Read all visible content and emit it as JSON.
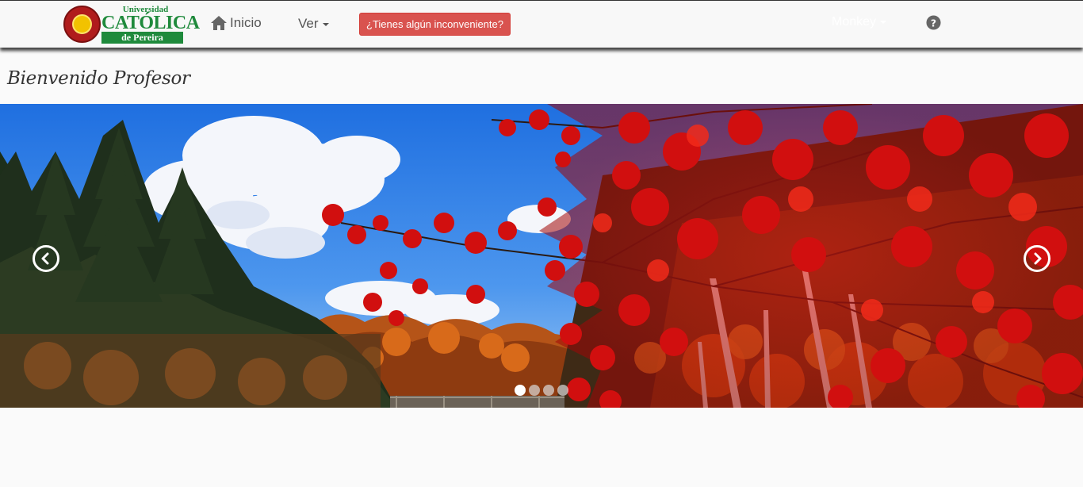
{
  "navbar": {
    "logo": {
      "line1": "Universidad",
      "line2": "CATÓLICA",
      "line3": "de Pereira"
    },
    "home": {
      "label": "Inicio",
      "icon": "home-icon"
    },
    "ver": {
      "label": "Ver"
    },
    "help_button": {
      "label": "¿Tienes algún inconveniente?",
      "color": "#d9534f"
    },
    "user_menu": {
      "label": "Monkey"
    },
    "question_icon": "question-circle-icon"
  },
  "page": {
    "title": "Bienvenido Profesor"
  },
  "carousel": {
    "slide_count": 4,
    "active_slide": 1,
    "prev_icon": "chevron-left-icon",
    "next_icon": "chevron-right-icon"
  }
}
